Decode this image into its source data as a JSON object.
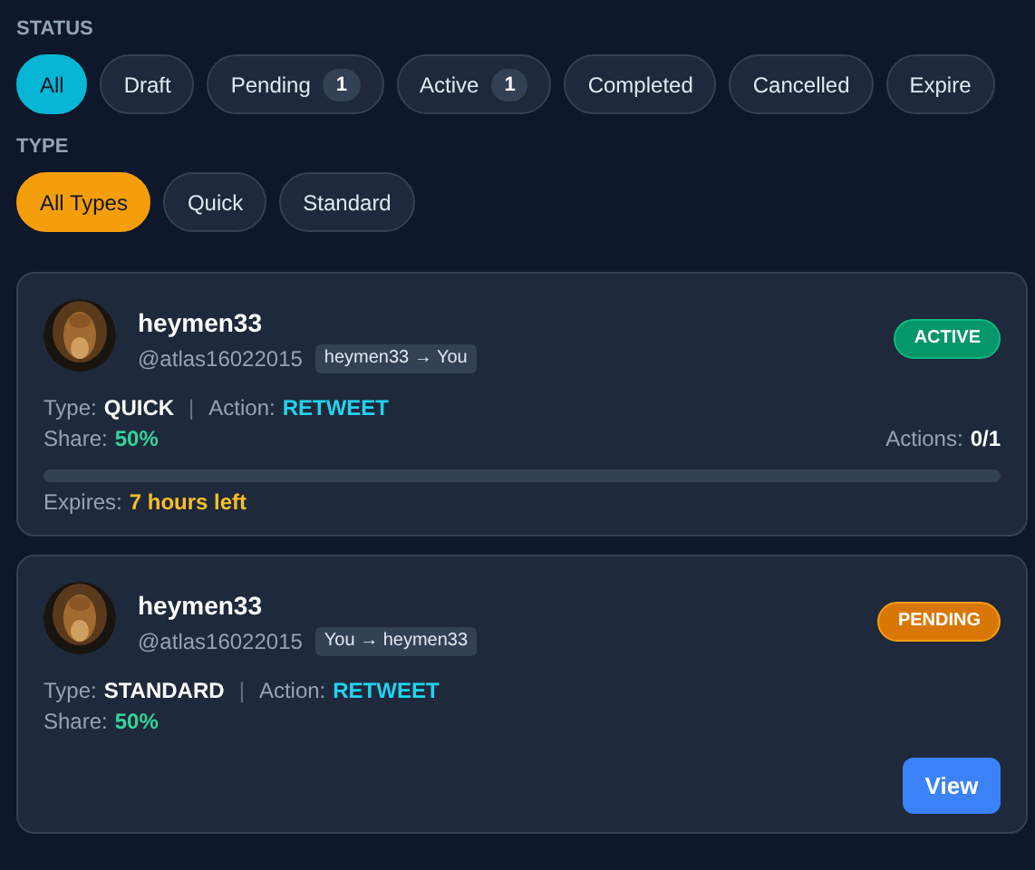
{
  "status_filter": {
    "label": "STATUS",
    "options": [
      {
        "label": "All",
        "selected": true
      },
      {
        "label": "Draft",
        "selected": false
      },
      {
        "label": "Pending",
        "count": "1",
        "selected": false
      },
      {
        "label": "Active",
        "count": "1",
        "selected": false
      },
      {
        "label": "Completed",
        "selected": false
      },
      {
        "label": "Cancelled",
        "selected": false
      },
      {
        "label": "Expire",
        "selected": false
      }
    ]
  },
  "type_filter": {
    "label": "TYPE",
    "options": [
      {
        "label": "All Types",
        "selected": true
      },
      {
        "label": "Quick",
        "selected": false
      },
      {
        "label": "Standard",
        "selected": false
      }
    ]
  },
  "cards": [
    {
      "name": "heymen33",
      "handle": "@atlas16022015",
      "direction": "heymen33 → You",
      "status": {
        "label": "ACTIVE",
        "kind": "active"
      },
      "type_label": "Type:",
      "type_value": "QUICK",
      "separator": "|",
      "action_label": "Action:",
      "action_value": "RETWEET",
      "share_label": "Share:",
      "share_value": "50%",
      "actions_label": "Actions:",
      "actions_value": "0/1",
      "progress": {
        "level": 0
      },
      "expires_label": "Expires:",
      "expires_value": "7 hours left"
    },
    {
      "name": "heymen33",
      "handle": "@atlas16022015",
      "direction": "You → heymen33",
      "status": {
        "label": "PENDING",
        "kind": "pending"
      },
      "type_label": "Type:",
      "type_value": "STANDARD",
      "separator": "|",
      "action_label": "Action:",
      "action_value": "RETWEET",
      "share_label": "Share:",
      "share_value": "50%",
      "button": "View"
    }
  ]
}
